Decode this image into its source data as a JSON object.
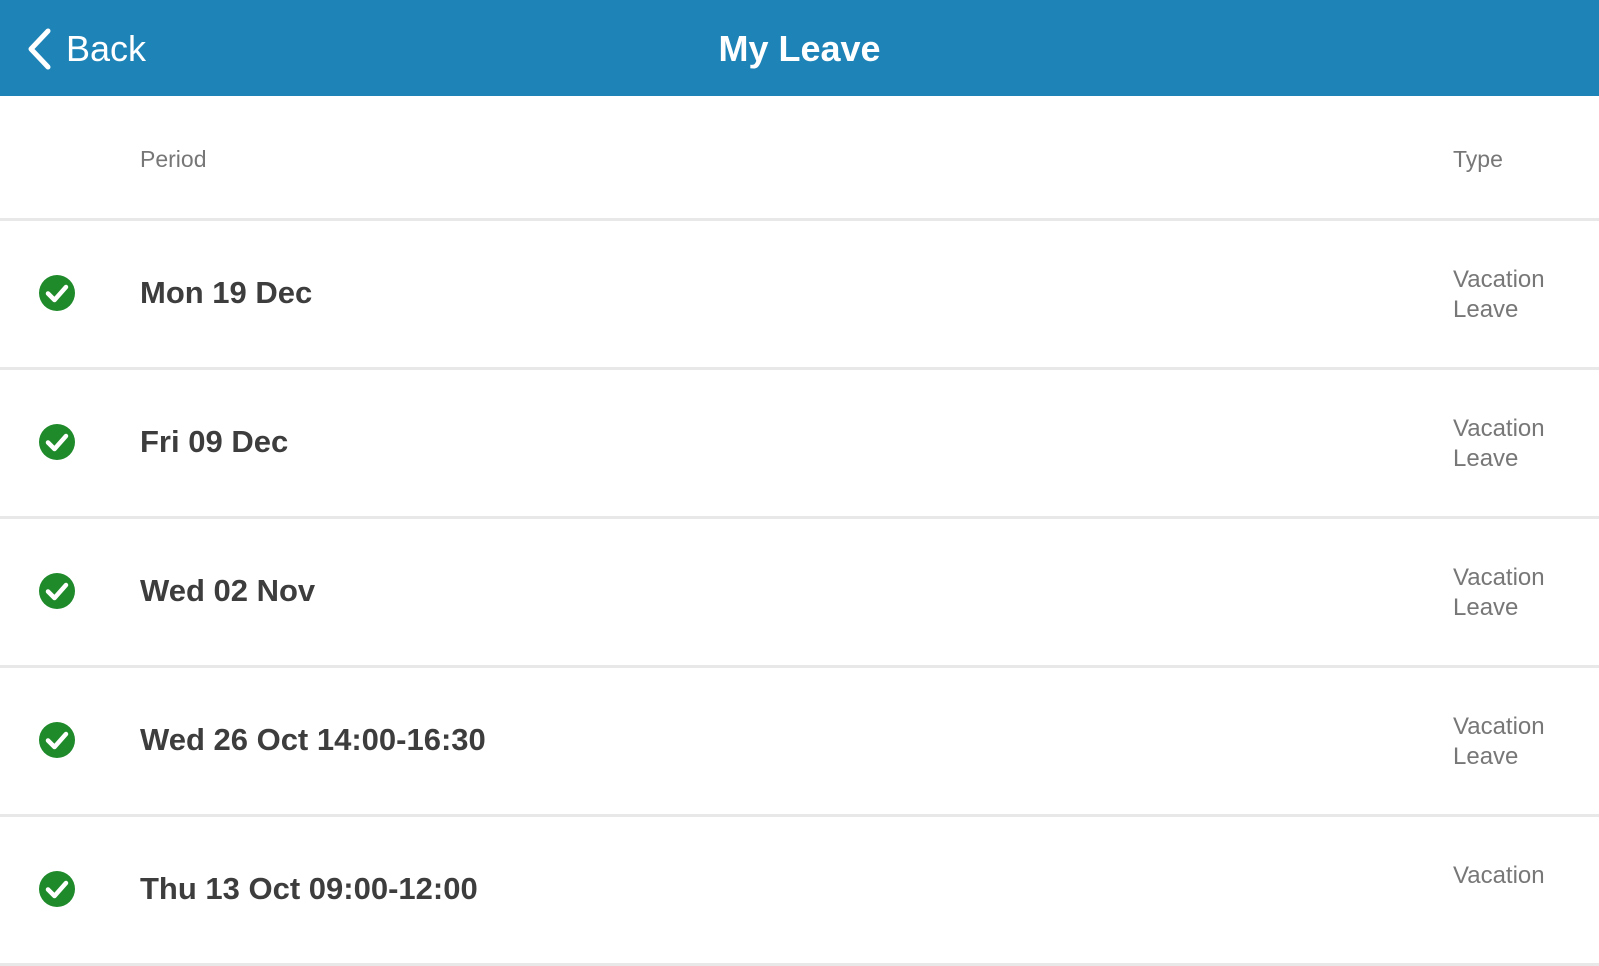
{
  "header": {
    "back_label": "Back",
    "title": "My Leave",
    "background_color": "#1e84b8"
  },
  "columns": {
    "period": "Period",
    "type": "Type"
  },
  "leave_items": [
    {
      "period": "Mon 19 Dec",
      "type": "Vacation Leave",
      "status": "approved",
      "status_icon": "check-circle-icon"
    },
    {
      "period": "Fri 09 Dec",
      "type": "Vacation Leave",
      "status": "approved",
      "status_icon": "check-circle-icon"
    },
    {
      "period": "Wed 02 Nov",
      "type": "Vacation Leave",
      "status": "approved",
      "status_icon": "check-circle-icon"
    },
    {
      "period": "Wed 26 Oct 14:00-16:30",
      "type": "Vacation Leave",
      "status": "approved",
      "status_icon": "check-circle-icon"
    },
    {
      "period": "Thu 13 Oct 09:00-12:00",
      "type": "Vacation",
      "status": "approved",
      "status_icon": "check-circle-icon"
    }
  ],
  "colors": {
    "approved": "#1e8a2a"
  }
}
